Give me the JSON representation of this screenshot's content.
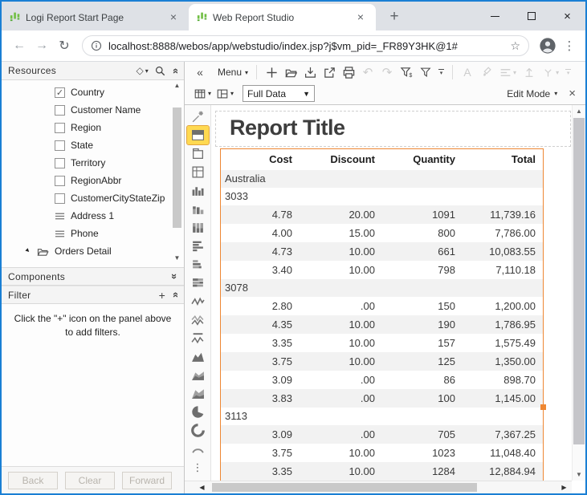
{
  "browser": {
    "tabs": [
      {
        "title": "Logi Report Start Page",
        "active": false
      },
      {
        "title": "Web Report Studio",
        "active": true
      }
    ],
    "url": "localhost:8888/webos/app/webstudio/index.jsp?j$vm_pid=_FR89Y3HK@1#"
  },
  "resources_panel": {
    "title": "Resources",
    "items": [
      {
        "icon": "checkbox-checked",
        "label": "Country"
      },
      {
        "icon": "checkbox",
        "label": "Customer Name"
      },
      {
        "icon": "checkbox",
        "label": "Region"
      },
      {
        "icon": "checkbox",
        "label": "State"
      },
      {
        "icon": "checkbox",
        "label": "Territory"
      },
      {
        "icon": "checkbox",
        "label": "RegionAbbr"
      },
      {
        "icon": "checkbox",
        "label": "CustomerCityStateZip"
      },
      {
        "icon": "field",
        "label": "Address 1"
      },
      {
        "icon": "field",
        "label": "Phone"
      },
      {
        "icon": "folder-open",
        "label": "Orders Detail",
        "expanded": true
      }
    ]
  },
  "components_panel": {
    "title": "Components"
  },
  "filter_panel": {
    "title": "Filter",
    "hint": "Click the \"+\" icon on the panel above to add filters."
  },
  "nav_buttons": {
    "back": "Back",
    "clear": "Clear",
    "forward": "Forward"
  },
  "toolbar": {
    "menu_label": "Menu",
    "view_mode_value": "Full Data",
    "edit_mode_label": "Edit Mode"
  },
  "palette": {
    "items": [
      {
        "name": "report-wizard",
        "selected": false
      },
      {
        "name": "banded-object",
        "selected": true
      },
      {
        "name": "tabular",
        "selected": false
      },
      {
        "name": "crosstab",
        "selected": false
      },
      {
        "name": "chart-column",
        "selected": false
      },
      {
        "name": "chart-bench-column",
        "selected": false
      },
      {
        "name": "chart-stacked-column",
        "selected": false
      },
      {
        "name": "chart-bar",
        "selected": false
      },
      {
        "name": "chart-bench-bar",
        "selected": false
      },
      {
        "name": "chart-stacked-bar",
        "selected": false
      },
      {
        "name": "chart-line",
        "selected": false
      },
      {
        "name": "chart-multi-line",
        "selected": false
      },
      {
        "name": "chart-capped-line",
        "selected": false
      },
      {
        "name": "chart-area",
        "selected": false
      },
      {
        "name": "chart-stacked-area",
        "selected": false
      },
      {
        "name": "chart-bench-area",
        "selected": false
      },
      {
        "name": "chart-pie",
        "selected": false
      },
      {
        "name": "chart-donut",
        "selected": false
      },
      {
        "name": "chart-gauge",
        "selected": false
      },
      {
        "name": "more-components",
        "selected": false
      }
    ]
  },
  "report": {
    "title": "Report Title",
    "table": {
      "headers": [
        "Cost",
        "Discount",
        "Quantity",
        "Total"
      ],
      "rows": [
        {
          "type": "group",
          "label": "Australia"
        },
        {
          "type": "group",
          "label": "3033"
        },
        {
          "type": "data",
          "cells": [
            "4.78",
            "20.00",
            "1091",
            "11,739.16"
          ]
        },
        {
          "type": "data",
          "cells": [
            "4.00",
            "15.00",
            "800",
            "7,786.00"
          ]
        },
        {
          "type": "data",
          "cells": [
            "4.73",
            "10.00",
            "661",
            "10,083.55"
          ]
        },
        {
          "type": "data",
          "cells": [
            "3.40",
            "10.00",
            "798",
            "7,110.18"
          ]
        },
        {
          "type": "group",
          "label": "3078"
        },
        {
          "type": "data",
          "cells": [
            "2.80",
            ".00",
            "150",
            "1,200.00"
          ]
        },
        {
          "type": "data",
          "cells": [
            "4.35",
            "10.00",
            "190",
            "1,786.95"
          ]
        },
        {
          "type": "data",
          "cells": [
            "3.35",
            "10.00",
            "157",
            "1,575.49"
          ]
        },
        {
          "type": "data",
          "cells": [
            "3.75",
            "10.00",
            "125",
            "1,350.00"
          ]
        },
        {
          "type": "data",
          "cells": [
            "3.09",
            ".00",
            "86",
            "898.70"
          ]
        },
        {
          "type": "data",
          "cells": [
            "3.83",
            ".00",
            "100",
            "1,145.00"
          ]
        },
        {
          "type": "group",
          "label": "3113"
        },
        {
          "type": "data",
          "cells": [
            "3.09",
            ".00",
            "705",
            "7,367.25"
          ]
        },
        {
          "type": "data",
          "cells": [
            "3.75",
            "10.00",
            "1023",
            "11,048.40"
          ]
        },
        {
          "type": "data",
          "cells": [
            "3.35",
            "10.00",
            "1284",
            "12,884.94"
          ]
        }
      ]
    }
  },
  "colors": {
    "window_border": "#1a7fd4",
    "table_border": "#ee8733",
    "palette_highlight": "#ffd951",
    "row_alt": "#f2f2f2",
    "logo_green": "#71bf44"
  }
}
